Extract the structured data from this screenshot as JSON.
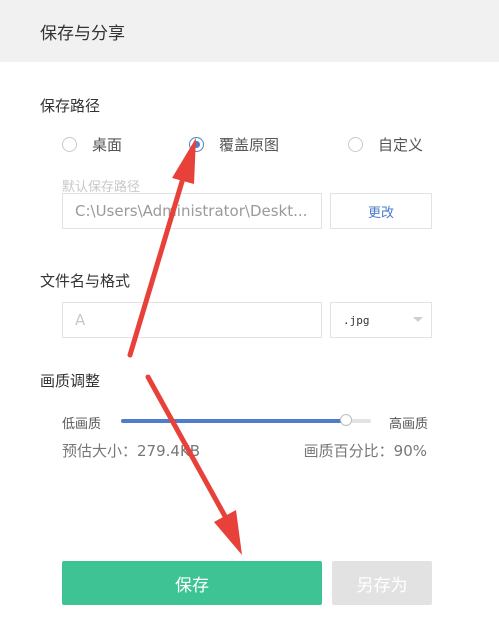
{
  "header": {
    "title": "保存与分享"
  },
  "save_path": {
    "title": "保存路径",
    "options": [
      {
        "label": "桌面",
        "checked": false
      },
      {
        "label": "覆盖原图",
        "checked": true
      },
      {
        "label": "自定义",
        "checked": false
      }
    ],
    "default_label": "默认保存路径",
    "path_value": "C:\\Users\\Administrator\\Deskt...",
    "change_button": "更改"
  },
  "file": {
    "title": "文件名与格式",
    "name_value": "A",
    "format_selected": ".jpg"
  },
  "quality": {
    "title": "画质调整",
    "low_label": "低画质",
    "high_label": "高画质",
    "slider_level_percent": 90,
    "estimated_size": "预估大小：279.4KB",
    "percentage_text": "画质百分比：90%"
  },
  "actions": {
    "save_label": "保存",
    "save_as_label": "另存为"
  },
  "colors": {
    "accent": "#4f7ccc",
    "primary_button": "#3ec494",
    "annotation_arrow": "#e8413a"
  }
}
